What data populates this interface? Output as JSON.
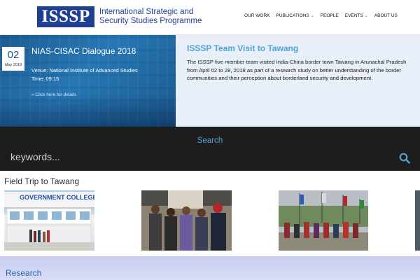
{
  "header": {
    "logo_text": "ISSSP",
    "org_line1": "International Strategic and",
    "org_line2": "Security Studies Programme",
    "nav": [
      {
        "label": "OUR WORK"
      },
      {
        "label": "PUBLICATIONS",
        "caret": "⌄"
      },
      {
        "label": "PEOPLE"
      },
      {
        "label": "EVENTS",
        "caret": "⌄"
      },
      {
        "label": "ABOUT US"
      }
    ]
  },
  "event": {
    "day": "02",
    "month": "May 2018",
    "title": "NIAS-CISAC Dialogue 2018",
    "venue": "Venue: National Institute of Advanced Studies",
    "time": "Time: 09:15",
    "link": "» Click here for details"
  },
  "news": {
    "title": "ISSSP Team Visit to Tawang",
    "body": "The ISSSP five member team visited India-China border town Tawang in Arunachal Pradesh from April 02 to 28, 2018 as part of a research study on better understanding of the border communities and their perception about borderland security and development."
  },
  "search": {
    "label": "Search",
    "placeholder": "keywords..."
  },
  "field_trip": {
    "title": "Field Trip to Tawang",
    "college_sign": "GOVERNMENT COLLEGE"
  },
  "research": {
    "title": "Research"
  },
  "colors": {
    "brand_blue": "#1f3f93",
    "accent_blue": "#4fa3d6",
    "search_bg": "#1d1d1d"
  }
}
